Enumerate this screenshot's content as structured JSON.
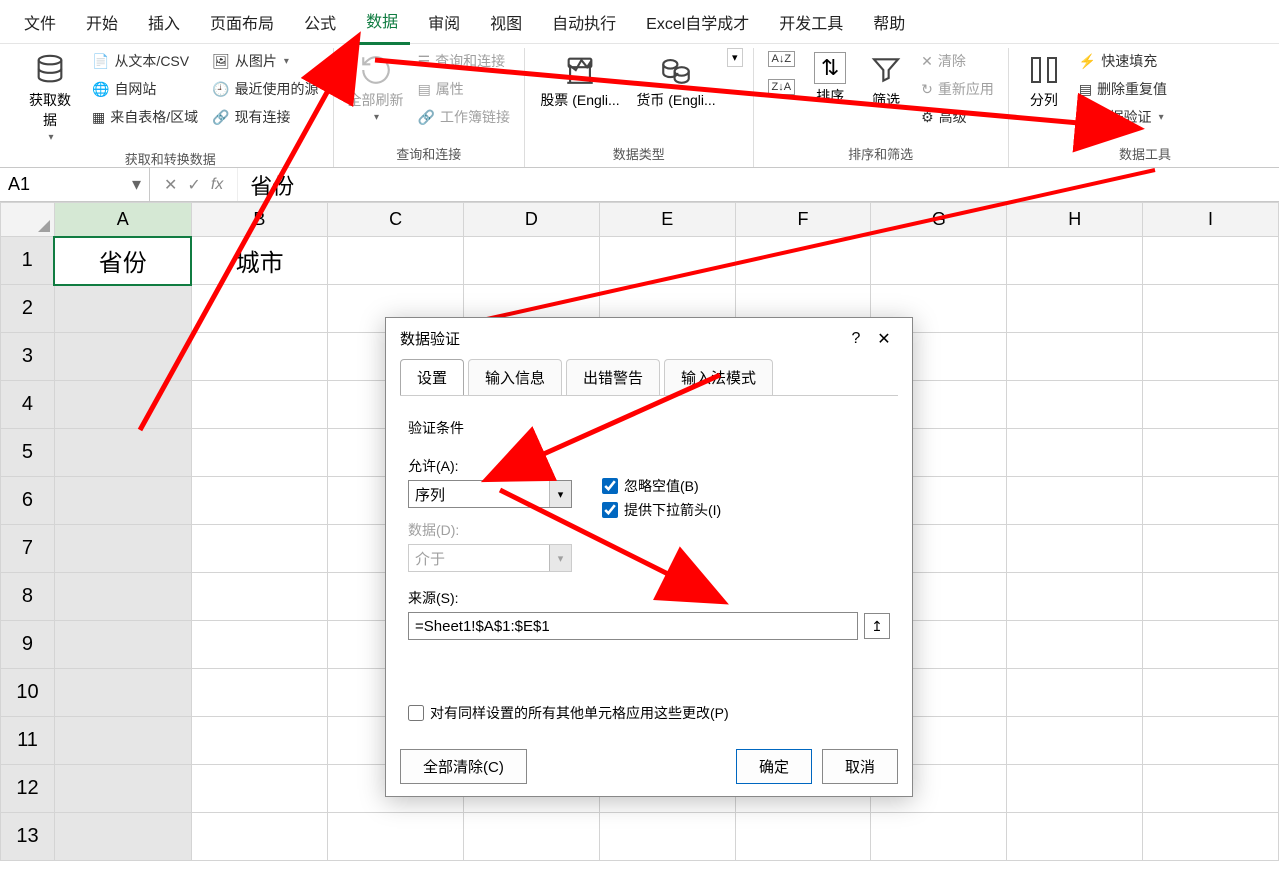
{
  "tabs": {
    "file": "文件",
    "home": "开始",
    "insert": "插入",
    "layout": "页面布局",
    "formulas": "公式",
    "data": "数据",
    "review": "审阅",
    "view": "视图",
    "automate": "自动执行",
    "custom1": "Excel自学成才",
    "developer": "开发工具",
    "help": "帮助"
  },
  "ribbon": {
    "group1": {
      "get_data": "获取数\n据",
      "from_text": "从文本/CSV",
      "from_web": "自网站",
      "from_table": "来自表格/区域",
      "from_pic": "从图片",
      "recent": "最近使用的源",
      "existing": "现有连接",
      "label": "获取和转换数据"
    },
    "group2": {
      "refresh": "全部刷新",
      "queries": "查询和连接",
      "properties": "属性",
      "edit_links": "工作簿链接",
      "label": "查询和连接"
    },
    "group3": {
      "stocks": "股票 (Engli...",
      "currency": "货币 (Engli...",
      "label": "数据类型"
    },
    "group4": {
      "sort": "排序",
      "filter": "筛选",
      "clear": "清除",
      "reapply": "重新应用",
      "advanced": "高级",
      "label": "排序和筛选"
    },
    "group5": {
      "text_to_cols": "分列",
      "flash_fill": "快速填充",
      "remove_dup": "删除重复值",
      "data_validation": "数据验证",
      "label": "数据工具"
    }
  },
  "formula_bar": {
    "name_box": "A1",
    "value": "省份"
  },
  "columns": [
    "A",
    "B",
    "C",
    "D",
    "E",
    "F",
    "G",
    "H",
    "I"
  ],
  "rows": [
    1,
    2,
    3,
    4,
    5,
    6,
    7,
    8,
    9,
    10,
    11,
    12,
    13
  ],
  "cells": {
    "A1": "省份",
    "B1": "城市"
  },
  "dialog": {
    "title": "数据验证",
    "tabs": {
      "settings": "设置",
      "input_msg": "输入信息",
      "error_alert": "出错警告",
      "ime_mode": "输入法模式"
    },
    "section_label": "验证条件",
    "allow_label": "允许(A):",
    "allow_value": "序列",
    "ignore_blank_label": "忽略空值(B)",
    "dropdown_label": "提供下拉箭头(I)",
    "data_label": "数据(D):",
    "data_value": "介于",
    "source_label": "来源(S):",
    "source_value": "=Sheet1!$A$1:$E$1",
    "apply_all_label": "对有同样设置的所有其他单元格应用这些更改(P)",
    "clear_all": "全部清除(C)",
    "ok": "确定",
    "cancel": "取消"
  }
}
